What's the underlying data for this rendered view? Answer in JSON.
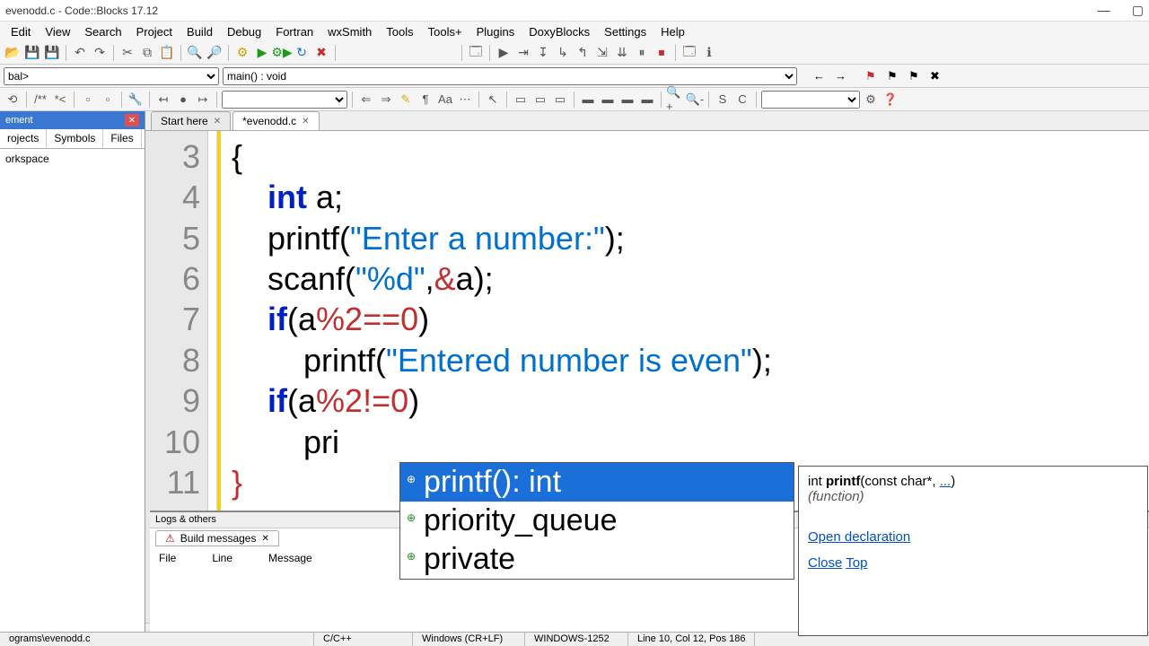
{
  "title": "evenodd.c - Code::Blocks 17.12",
  "menu": [
    "Edit",
    "View",
    "Search",
    "Project",
    "Build",
    "Debug",
    "Fortran",
    "wxSmith",
    "Tools",
    "Tools+",
    "Plugins",
    "DoxyBlocks",
    "Settings",
    "Help"
  ],
  "scope_selector": "bal>",
  "func_selector": "main() : void",
  "sidebar": {
    "title": "ement",
    "tabs": [
      "rojects",
      "Symbols",
      "Files"
    ],
    "tree_root": "orkspace"
  },
  "file_tabs": [
    {
      "label": "Start here",
      "active": false
    },
    {
      "label": "*evenodd.c",
      "active": true
    }
  ],
  "code": {
    "first_line": 3,
    "lines": [
      {
        "n": 3,
        "t": [
          {
            "c": "p",
            "s": "{"
          }
        ]
      },
      {
        "n": 4,
        "t": [
          {
            "c": "",
            "s": "    "
          },
          {
            "c": "kw",
            "s": "int"
          },
          {
            "c": "",
            "s": " a;"
          }
        ]
      },
      {
        "n": 5,
        "t": [
          {
            "c": "",
            "s": "    printf("
          },
          {
            "c": "str",
            "s": "\"Enter a number:\""
          },
          {
            "c": "",
            "s": ");"
          }
        ]
      },
      {
        "n": 6,
        "t": [
          {
            "c": "",
            "s": "    scanf("
          },
          {
            "c": "str",
            "s": "\"%d\""
          },
          {
            "c": "",
            "s": ","
          },
          {
            "c": "op",
            "s": "&"
          },
          {
            "c": "",
            "s": "a);"
          }
        ]
      },
      {
        "n": 7,
        "t": [
          {
            "c": "",
            "s": "    "
          },
          {
            "c": "kw",
            "s": "if"
          },
          {
            "c": "",
            "s": "(a"
          },
          {
            "c": "op",
            "s": "%"
          },
          {
            "c": "num",
            "s": "2"
          },
          {
            "c": "op",
            "s": "=="
          },
          {
            "c": "num",
            "s": "0"
          },
          {
            "c": "",
            "s": ")"
          }
        ]
      },
      {
        "n": 8,
        "t": [
          {
            "c": "",
            "s": "        printf("
          },
          {
            "c": "str",
            "s": "\"Entered number is even\""
          },
          {
            "c": "",
            "s": ");"
          }
        ]
      },
      {
        "n": 9,
        "t": [
          {
            "c": "",
            "s": "    "
          },
          {
            "c": "kw",
            "s": "if"
          },
          {
            "c": "",
            "s": "(a"
          },
          {
            "c": "op",
            "s": "%"
          },
          {
            "c": "num",
            "s": "2"
          },
          {
            "c": "op",
            "s": "!="
          },
          {
            "c": "num",
            "s": "0"
          },
          {
            "c": "",
            "s": ")"
          }
        ]
      },
      {
        "n": 10,
        "t": [
          {
            "c": "",
            "s": "        pri"
          }
        ]
      },
      {
        "n": 11,
        "t": [
          {
            "c": "op",
            "s": "}"
          }
        ]
      }
    ]
  },
  "autocomplete": [
    {
      "label": "printf(): int",
      "sel": true
    },
    {
      "label": "priority_queue",
      "sel": false
    },
    {
      "label": "private",
      "sel": false
    }
  ],
  "tooltip": {
    "sig_pre": "int ",
    "sig_name": "printf",
    "sig_post": "(const char*, ",
    "sig_dots": "...",
    "sig_end": ")",
    "kind": "(function)",
    "link1": "Open declaration",
    "link2": "Close",
    "link3": "Top"
  },
  "logs": {
    "header": "Logs & others",
    "tab": "Build messages",
    "cols": [
      "File",
      "Line",
      "Message"
    ]
  },
  "status": {
    "path": "ograms\\evenodd.c",
    "lang": "C/C++",
    "eol": "Windows (CR+LF)",
    "enc": "WINDOWS-1252",
    "pos": "Line 10, Col 12, Pos 186"
  }
}
